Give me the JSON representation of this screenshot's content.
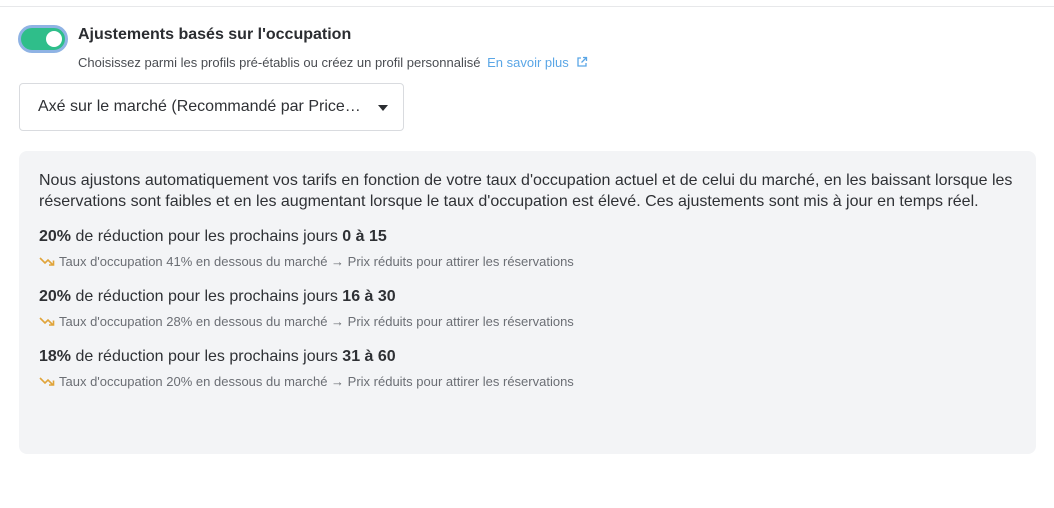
{
  "toggle": {
    "on": true,
    "color": "#2fbe8a"
  },
  "header": {
    "title": "Ajustements basés sur l'occupation",
    "subtitle": "Choisissez parmi les profils pré-établis ou créez un profil personnalisé",
    "link": "En savoir plus",
    "link_icon": "external-link-icon"
  },
  "select": {
    "value": "Axé sur le marché (Recommandé par PriceLabs)",
    "icon": "caret-down-icon"
  },
  "panel": {
    "description": "Nous ajustons automatiquement vos tarifs en fonction de votre taux d'occupation actuel et de celui du marché, en les baissant lorsque les réservations sont faibles et en les augmentant lorsque le taux d'occupation est élevé. Ces ajustements sont mis à jour en temps réel.",
    "tiers": [
      {
        "percent": "20%",
        "text": " de réduction pour les prochains jours ",
        "range": "0 à 15",
        "note": "Taux d'occupation 41% en dessous du marché → Prix réduits pour attirer les réservations"
      },
      {
        "percent": "20%",
        "text": " de réduction pour les prochains jours ",
        "range": "16 à 30",
        "note": "Taux d'occupation 28% en dessous du marché → Prix réduits pour attirer les réservations"
      },
      {
        "percent": "18%",
        "text": " de réduction pour les prochains jours ",
        "range": "31 à 60",
        "note": "Taux d'occupation 20% en dessous du marché → Prix réduits pour attirer les réservations"
      }
    ],
    "trend_icon_color": "#e0a43a"
  }
}
